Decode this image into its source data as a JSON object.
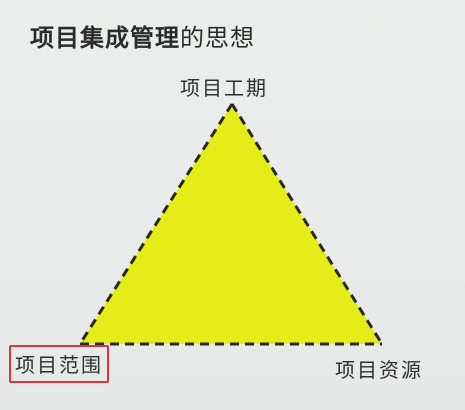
{
  "slide": {
    "title_bold": "项目集成管理",
    "title_rest": "的思想"
  },
  "diagram": {
    "top_label": "项目工期",
    "left_label": "项目范围",
    "right_label": "项目资源",
    "fill_color": "#e5ec18",
    "stroke_color": "#2a2a1a",
    "highlight_color": "#e0303a"
  }
}
